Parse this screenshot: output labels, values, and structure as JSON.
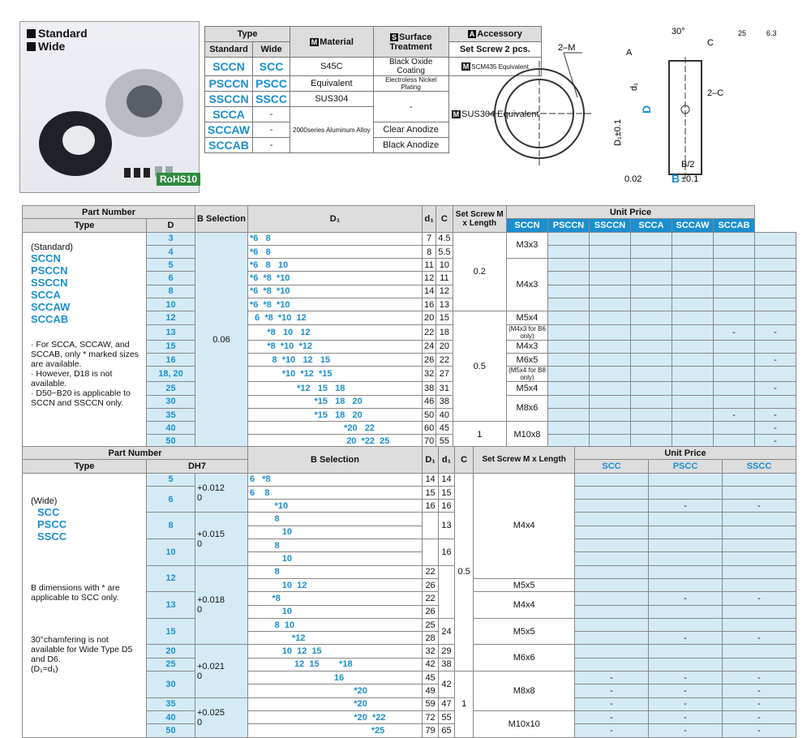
{
  "photo": {
    "standard": "Standard",
    "wide": "Wide",
    "rohs": "RoHS10"
  },
  "spec": {
    "header": {
      "type": "Type",
      "standard": "Standard",
      "wide": "Wide",
      "material": "Material",
      "surface": "Surface Treatment",
      "accessory": "Accessory",
      "acc_sub": "Set Screw 2 pcs."
    },
    "rows": [
      {
        "std": "SCCN",
        "wide": "SCC",
        "material": "S45C",
        "surface": "Black Oxide Coating",
        "acc": "SCM435 Equivalent"
      },
      {
        "std": "PSCCN",
        "wide": "PSCC",
        "material": "Equivalent",
        "surface": "Electroless Nickel Plating",
        "acc": ""
      },
      {
        "std": "SSCCN",
        "wide": "SSCC",
        "material": "SUS304",
        "surface": "-",
        "acc": "SUS304 Equivalent"
      },
      {
        "std": "SCCA",
        "wide": "-",
        "material": "",
        "surface": "",
        "acc": ""
      },
      {
        "std": "SCCAW",
        "wide": "-",
        "material": "2000series Aluminum Alloy",
        "surface": "Clear Anodize",
        "acc": ""
      },
      {
        "std": "SCCAB",
        "wide": "-",
        "material": "",
        "surface": "Black Anodize",
        "acc": ""
      }
    ]
  },
  "drawing": {
    "m": "2–M",
    "c": "C",
    "c2": "2–C",
    "angle": "30°",
    "d1": "D₁±0.1",
    "d": "D",
    "di": "d₁",
    "b2": "B/2",
    "b": "B",
    "tol": "0.02",
    "ra": "6.3",
    "rough1": "25",
    "rough2": "6.3",
    "a": "A",
    "bt": "±0.1"
  },
  "table1": {
    "h_part": "Part Number",
    "h_type": "Type",
    "h_d": "D",
    "h_bsel": "B Selection",
    "h_d1": "D₁",
    "h_di": "d₁",
    "h_c": "C",
    "h_screw": "Set Screw M x Length",
    "h_price": "Unit Price",
    "price_cols": [
      "SCCN",
      "PSCCN",
      "SSCCN",
      "SCCA",
      "SCCAW",
      "SCCAB"
    ],
    "type_std": "(Standard)",
    "types": [
      "SCCN",
      "PSCCN",
      "SSCCN",
      "SCCA",
      "SCCAW",
      "SCCAB"
    ],
    "notes": [
      "· For SCCA, SCCAW, and SCCAB, only * marked sizes are available.",
      "· However, D18 is not available.",
      "· D50~B20 is applicable to SCCN and SSCCN only."
    ],
    "tol": "0.06",
    "rows": [
      {
        "d": "3",
        "b": "*6   8",
        "D1": "7",
        "d1": "4.5"
      },
      {
        "d": "4",
        "b": "*6   8",
        "D1": "8",
        "d1": "5.5"
      },
      {
        "d": "5",
        "b": "*6   8   10",
        "D1": "11",
        "d1": "10"
      },
      {
        "d": "6",
        "b": "*6  *8  *10",
        "D1": "12",
        "d1": "11"
      },
      {
        "d": "8",
        "b": "*6  *8  *10",
        "D1": "14",
        "d1": "12"
      },
      {
        "d": "10",
        "b": "*6  *8  *10",
        "D1": "16",
        "d1": "13"
      },
      {
        "d": "12",
        "b": "  6  *8  *10  12",
        "D1": "20",
        "d1": "15"
      },
      {
        "d": "13",
        "b": "       *8   10   12",
        "D1": "22",
        "d1": "18"
      },
      {
        "d": "15",
        "b": "       *8  *10  *12",
        "D1": "24",
        "d1": "20"
      },
      {
        "d": "16",
        "b": "         8  *10   12   15",
        "D1": "26",
        "d1": "22"
      },
      {
        "d": "18, 20",
        "b": "             *10  *12  *15",
        "D1": "32",
        "d1": "27"
      },
      {
        "d": "25",
        "b": "                   *12   15   18",
        "D1": "38",
        "d1": "31"
      },
      {
        "d": "30",
        "b": "                          *15   18   20",
        "D1": "46",
        "d1": "38"
      },
      {
        "d": "35",
        "b": "                          *15   18   20",
        "D1": "50",
        "d1": "40"
      },
      {
        "d": "40",
        "b": "                                      *20   22",
        "D1": "60",
        "d1": "45"
      },
      {
        "d": "50",
        "b": "                                       20  *22  25",
        "D1": "70",
        "d1": "55"
      }
    ],
    "c": [
      "0.2",
      "0.5",
      "1"
    ],
    "screws": [
      "M3x3",
      "M4x3",
      "M5x4",
      "(M4x3 for B6 only)",
      "M4x3",
      "M6x5",
      "(M5x4 for B8 only)",
      "M5x4",
      "M8x6",
      "M10x8"
    ],
    "dash": "-"
  },
  "table2": {
    "h_part": "Part Number",
    "h_type": "Type",
    "h_d": "DH7",
    "h_bsel": "B Selection",
    "h_d1": "D₁",
    "h_di": "d₁",
    "h_c": "C",
    "h_screw": "Set Screw M x Length",
    "h_price": "Unit Price",
    "price_cols": [
      "SCC",
      "PSCC",
      "SSCC"
    ],
    "type_wide": "(Wide)",
    "types": [
      "SCC",
      "PSCC",
      "SSCC"
    ],
    "note1": "B dimensions with * are applicable to SCC only.",
    "note2": "30°chamfering is not available for Wide Type D5 and D6.",
    "note3": "(D₁=d₁)",
    "tols": [
      "+0.012",
      "0",
      "+0.015",
      "0",
      "+0.018",
      "0",
      "+0.021",
      "0",
      "+0.025",
      "0"
    ],
    "c": [
      "0.5",
      "1"
    ],
    "screws": [
      "M4x4",
      "M5x5",
      "M4x4",
      "M5x5",
      "M6x6",
      "M8x8",
      "M10x10"
    ],
    "rows": [
      {
        "d": "5",
        "b": "6   *8",
        "D1": "14",
        "d1": "14"
      },
      {
        "d": "6",
        "b": "6    8",
        "D1": "15",
        "d1": "15"
      },
      {
        "d": "",
        "b": "          *10",
        "D1": "16",
        "d1": "16"
      },
      {
        "d": "8",
        "b": "          8",
        "D1": "",
        "d1": "13"
      },
      {
        "d": "",
        "b": "             10",
        "D1": "18",
        "d1": ""
      },
      {
        "d": "10",
        "b": "          8",
        "D1": "",
        "d1": "16"
      },
      {
        "d": "",
        "b": "             10",
        "D1": "20",
        "d1": ""
      },
      {
        "d": "12",
        "b": "          8",
        "D1": "22",
        "d1": ""
      },
      {
        "d": "",
        "b": "             10  12",
        "D1": "26",
        "d1": "20"
      },
      {
        "d": "13",
        "b": "         *8",
        "D1": "22",
        "d1": ""
      },
      {
        "d": "",
        "b": "             10",
        "D1": "26",
        "d1": ""
      },
      {
        "d": "15",
        "b": "          8  10",
        "D1": "25",
        "d1": "24"
      },
      {
        "d": "",
        "b": "                 *12",
        "D1": "28",
        "d1": ""
      },
      {
        "d": "20",
        "b": "             10  12  15",
        "D1": "32",
        "d1": "29"
      },
      {
        "d": "25",
        "b": "                  12  15        *18",
        "D1": "42",
        "d1": "38"
      },
      {
        "d": "30",
        "b": "                                  16",
        "D1": "45",
        "d1": "42"
      },
      {
        "d": "",
        "b": "                                          *20",
        "D1": "49",
        "d1": ""
      },
      {
        "d": "35",
        "b": "                                          *20",
        "D1": "59",
        "d1": "47"
      },
      {
        "d": "40",
        "b": "                                          *20  *22",
        "D1": "72",
        "d1": "55"
      },
      {
        "d": "50",
        "b": "                                                 *25",
        "D1": "79",
        "d1": "65"
      }
    ],
    "dash": "-"
  }
}
